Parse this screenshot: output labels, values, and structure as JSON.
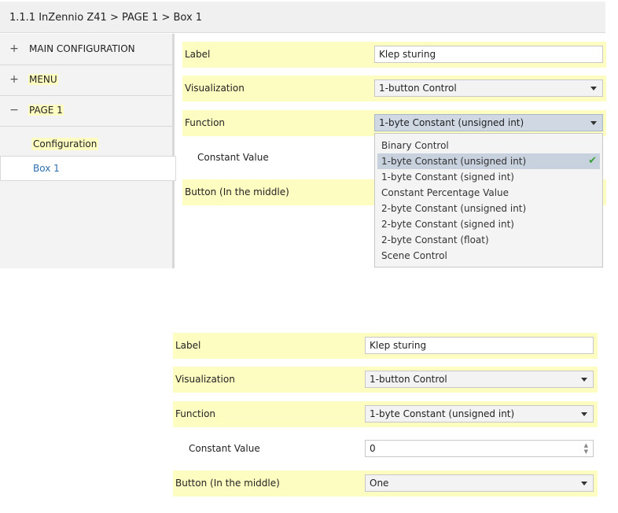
{
  "top": {
    "breadcrumb": "1.1.1 InZennio Z41 > PAGE 1 > Box 1",
    "sidebar": {
      "items": [
        {
          "toggle": "+",
          "label": "MAIN CONFIGURATION"
        },
        {
          "toggle": "+",
          "label": "MENU"
        },
        {
          "toggle": "−",
          "label": "PAGE 1"
        }
      ],
      "subitems": [
        {
          "label": "Configuration"
        },
        {
          "label": "Box 1"
        }
      ]
    },
    "params": {
      "label": {
        "name": "Label",
        "value": "Klep sturing"
      },
      "visualization": {
        "name": "Visualization",
        "value": "1-button Control"
      },
      "function": {
        "name": "Function",
        "value": "1-byte Constant (unsigned int)"
      },
      "constant": {
        "name": "Constant Value"
      },
      "button": {
        "name": "Button (In the middle)"
      }
    },
    "dropdown": {
      "options": [
        "Binary Control",
        "1-byte Constant (unsigned int)",
        "1-byte Constant (signed int)",
        "Constant Percentage Value",
        "2-byte Constant (unsigned int)",
        "2-byte Constant (signed int)",
        "2-byte Constant (float)",
        "Scene Control"
      ],
      "selected_index": 1,
      "check_icon": "✔"
    }
  },
  "bottom": {
    "params": {
      "label": {
        "name": "Label",
        "value": "Klep sturing"
      },
      "visualization": {
        "name": "Visualization",
        "value": "1-button Control"
      },
      "function": {
        "name": "Function",
        "value": "1-byte Constant (unsigned int)"
      },
      "constant": {
        "name": "Constant Value",
        "value": "0"
      },
      "button": {
        "name": "Button (In the middle)",
        "value": "One"
      }
    }
  },
  "colors": {
    "highlight": "#fdfdc2",
    "selected_nav_text": "#2e6fb0",
    "check": "#3aa13a"
  }
}
